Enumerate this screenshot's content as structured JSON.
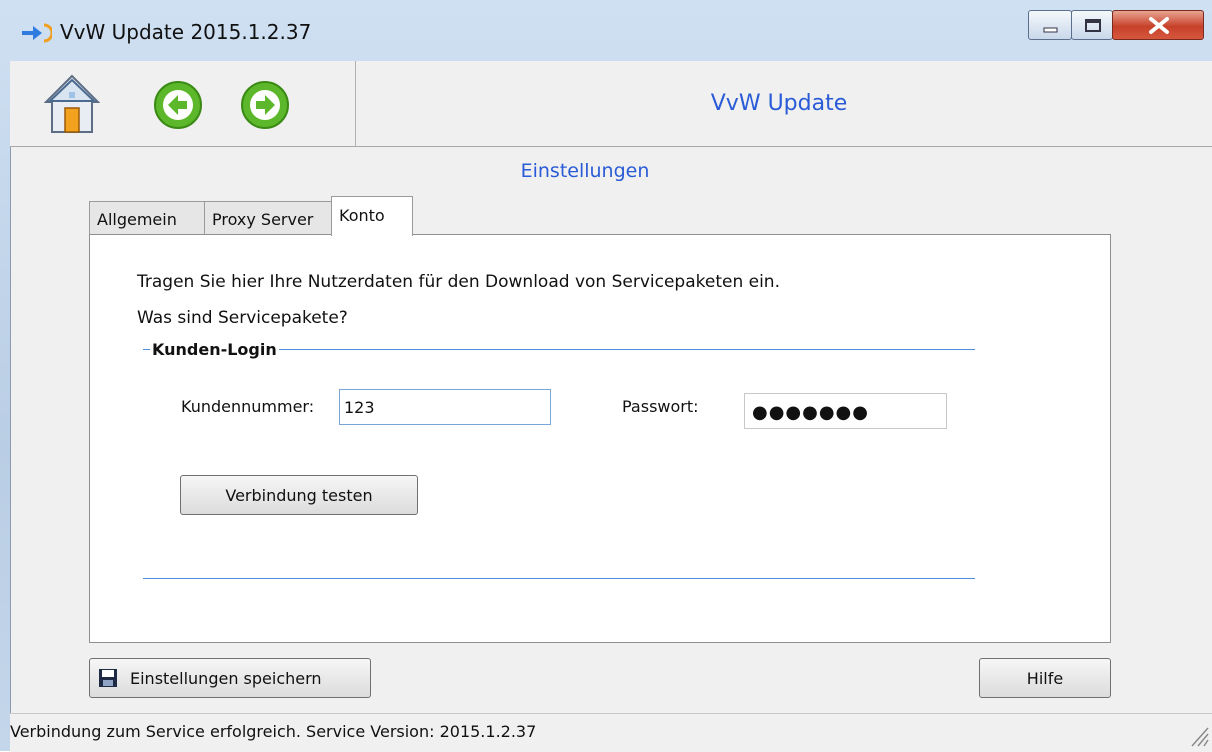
{
  "window": {
    "title": "VvW Update 2015.1.2.37"
  },
  "header": {
    "title": "VvW Update"
  },
  "section": {
    "title": "Einstellungen"
  },
  "tabs": [
    {
      "label": "Allgemein"
    },
    {
      "label": "Proxy Server"
    },
    {
      "label": "Konto"
    }
  ],
  "konto": {
    "intro_line1": "Tragen Sie hier Ihre Nutzerdaten für den Download von Servicepaketen ein.",
    "intro_line2": "Was sind Servicepakete?",
    "group_label": "Kunden-Login",
    "customer_number_label": "Kundennummer:",
    "customer_number_value": "123",
    "password_label": "Passwort:",
    "password_mask": "●●●●●●●",
    "test_button": "Verbindung testen"
  },
  "footer": {
    "save_button": "Einstellungen speichern",
    "help_button": "Hilfe"
  },
  "status": {
    "text": "Verbindung zum Service erfolgreich. Service Version: 2015.1.2.37"
  },
  "colors": {
    "accent_blue": "#2a5bd7",
    "groupbox_line": "#4d8ee0",
    "nav_green": "#5cb82a",
    "close_red": "#c7412a"
  },
  "icons": [
    "app-arrow-icon",
    "minimize-icon",
    "maximize-icon",
    "close-icon",
    "home-icon",
    "back-arrow-icon",
    "forward-arrow-icon",
    "save-icon",
    "resize-grip-icon"
  ]
}
